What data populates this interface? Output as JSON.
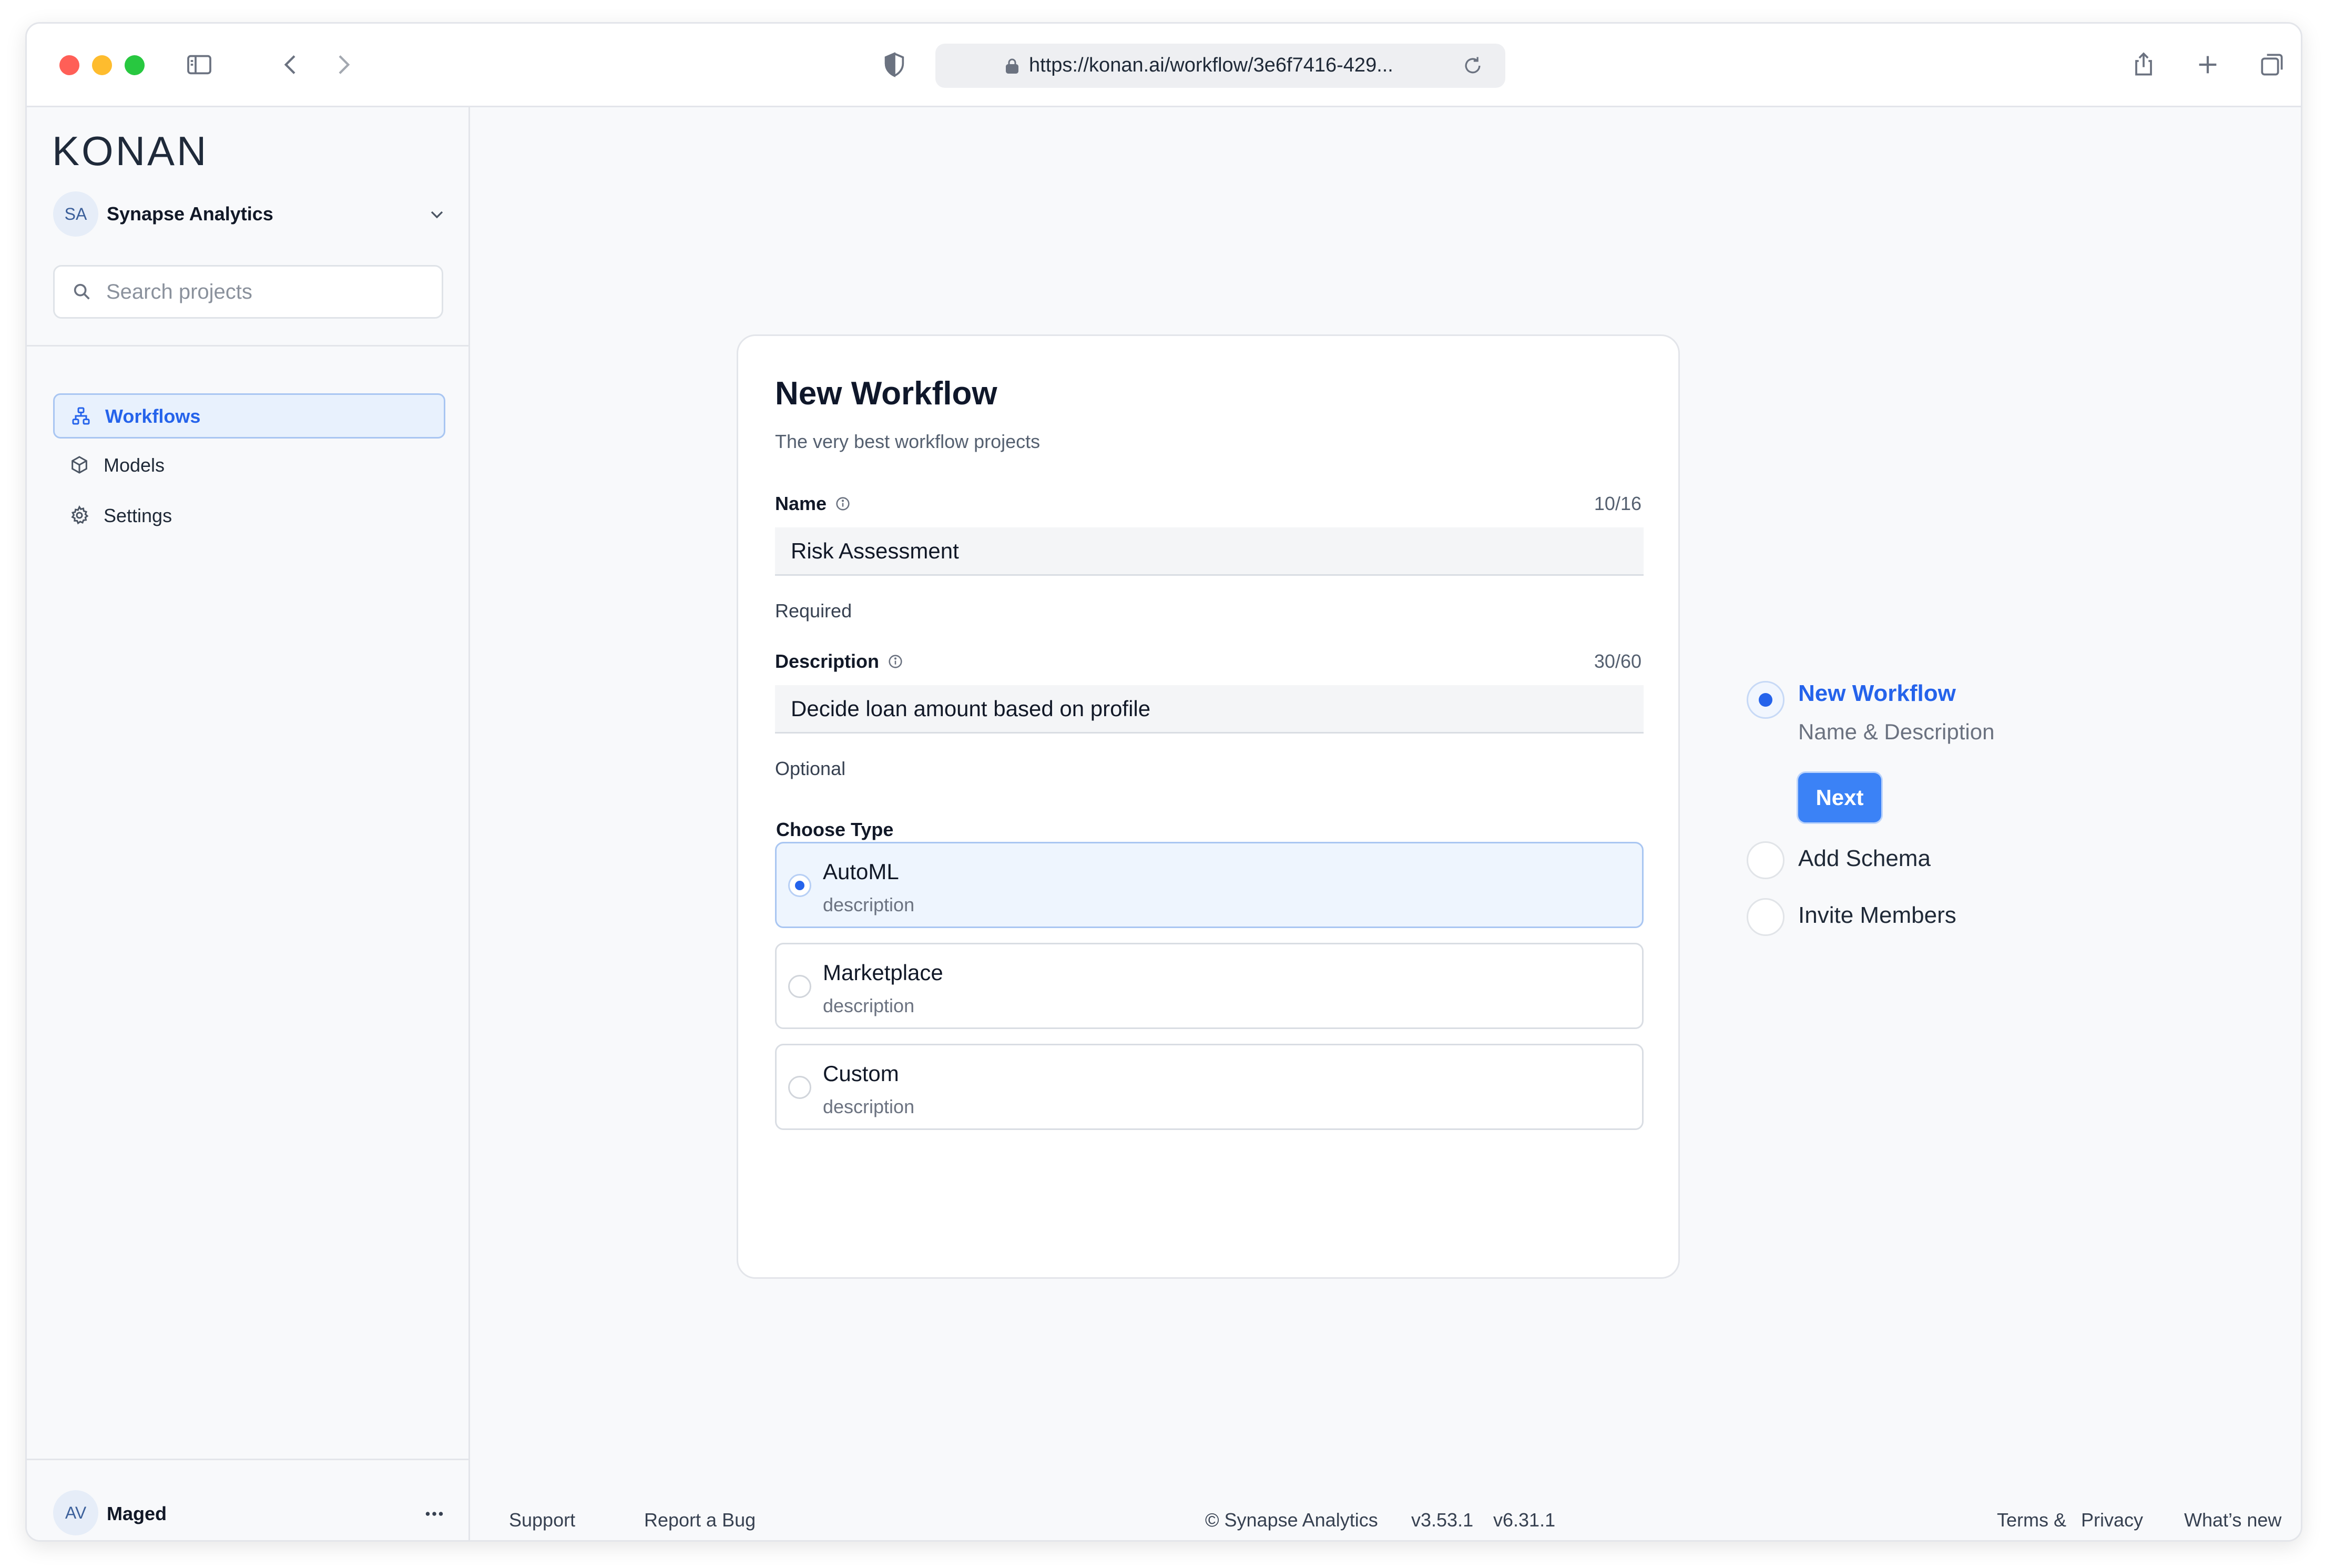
{
  "browser": {
    "url": "https://konan.ai/workflow/3e6f7416-429..."
  },
  "sidebar": {
    "logo": "KONAN",
    "org": {
      "initials": "SA",
      "name": "Synapse Analytics"
    },
    "search": {
      "placeholder": "Search projects",
      "value": ""
    },
    "items": [
      {
        "label": "Workflows",
        "icon": "workflow-icon",
        "active": true
      },
      {
        "label": "Models",
        "icon": "cube-icon",
        "active": false
      },
      {
        "label": "Settings",
        "icon": "gear-icon",
        "active": false
      }
    ],
    "user": {
      "initials": "AV",
      "name": "Maged"
    }
  },
  "form": {
    "title": "New Workflow",
    "subtitle": "The very best workflow projects",
    "name": {
      "label": "Name",
      "counter": "10/16",
      "value": "Risk Assessment",
      "hint": "Required"
    },
    "description": {
      "label": "Description",
      "counter": "30/60",
      "value": "Decide loan amount based on profile",
      "hint": "Optional"
    },
    "choose_type_label": "Choose Type",
    "types": [
      {
        "title": "AutoML",
        "description": "description",
        "selected": true
      },
      {
        "title": "Marketplace",
        "description": "description",
        "selected": false
      },
      {
        "title": "Custom",
        "description": "description",
        "selected": false
      }
    ]
  },
  "stepper": {
    "steps": [
      {
        "title": "New Workflow",
        "subtitle": "Name & Description",
        "active": true
      },
      {
        "title": "Add Schema",
        "active": false
      },
      {
        "title": "Invite Members",
        "active": false
      }
    ],
    "next_label": "Next"
  },
  "footer": {
    "support": "Support",
    "report_bug": "Report a Bug",
    "copyright": "© Synapse Analytics",
    "version_app": "v3.53.1",
    "version_ui": "v6.31.1",
    "terms": "Terms &",
    "privacy": "Privacy",
    "whats_new": "What’s new"
  },
  "colors": {
    "accent": "#2563eb",
    "button": "#3b82f6"
  }
}
